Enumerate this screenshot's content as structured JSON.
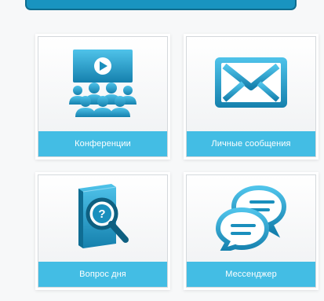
{
  "tiles": [
    {
      "label": "Конференции",
      "icon": "video-conference-icon"
    },
    {
      "label": "Личные сообщения",
      "icon": "envelope-icon"
    },
    {
      "label": "Вопрос дня",
      "icon": "question-book-icon"
    },
    {
      "label": "Мессенджер",
      "icon": "chat-bubbles-icon"
    }
  ],
  "colors": {
    "accent": "#43bde4",
    "accent_dark": "#1994c0",
    "icon_dark": "#1685b0"
  }
}
